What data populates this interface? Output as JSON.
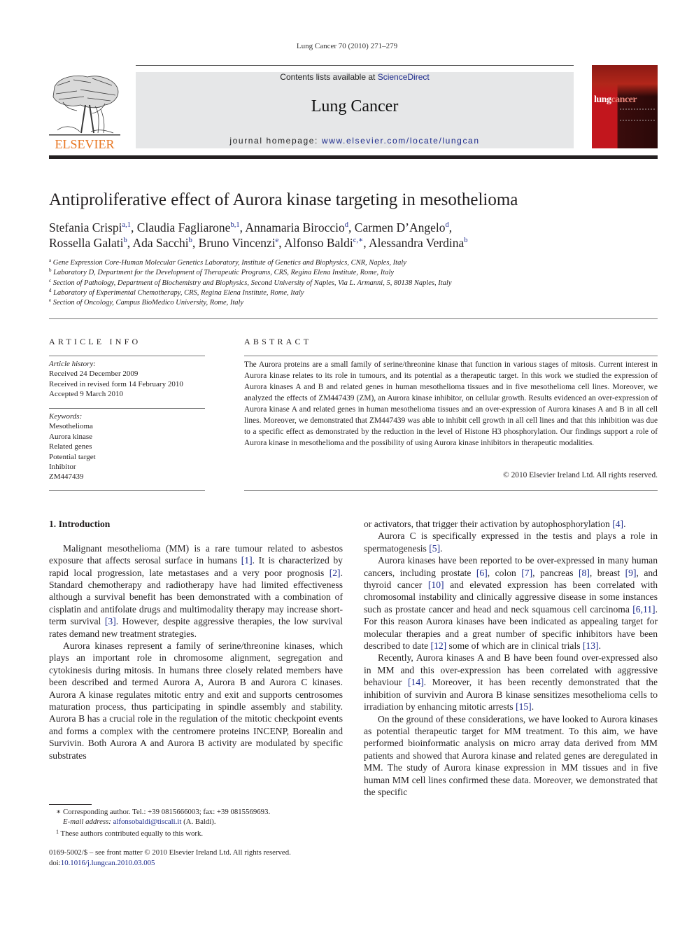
{
  "running_head": "Lung Cancer 70 (2010) 271–279",
  "masthead": {
    "publisher_logo_text": "ELSEVIER",
    "contents_prefix": "Contents lists available at ",
    "contents_link": "ScienceDirect",
    "journal_name": "Lung Cancer",
    "homepage_prefix": "journal homepage: ",
    "homepage_link": "www.elsevier.com/locate/lungcan",
    "cover_title_a": "lung",
    "cover_title_b": "cancer"
  },
  "article": {
    "title": "Antiproliferative effect of Aurora kinase targeting in mesothelioma",
    "authors": [
      {
        "name": "Stefania Crispi",
        "sup": "a,1",
        "sep": ", "
      },
      {
        "name": "Claudia Fagliarone",
        "sup": "b,1",
        "sep": ", "
      },
      {
        "name": "Annamaria Biroccio",
        "sup": "d",
        "sep": ", "
      },
      {
        "name": "Carmen D’Angelo",
        "sup": "d",
        "sep": ","
      },
      {
        "name": "Rossella Galati",
        "sup": "b",
        "sep": ", "
      },
      {
        "name": "Ada Sacchi",
        "sup": "b",
        "sep": ", "
      },
      {
        "name": "Bruno Vincenzi",
        "sup": "e",
        "sep": ", "
      },
      {
        "name": "Alfonso Baldi",
        "sup": "c,∗",
        "sep": ", "
      },
      {
        "name": "Alessandra Verdina",
        "sup": "b",
        "sep": ""
      }
    ],
    "affiliations": [
      {
        "key": "a",
        "text": "Gene Expression Core-Human Molecular Genetics Laboratory, Institute of Genetics and Biophysics, CNR, Naples, Italy"
      },
      {
        "key": "b",
        "text": "Laboratory D, Department for the Development of Therapeutic Programs, CRS, Regina Elena Institute, Rome, Italy"
      },
      {
        "key": "c",
        "text": "Section of Pathology, Department of Biochemistry and Biophysics, Second University of Naples, Via L. Armanni, 5, 80138 Naples, Italy"
      },
      {
        "key": "d",
        "text": "Laboratory of Experimental Chemotherapy, CRS, Regina Elena Institute, Rome, Italy"
      },
      {
        "key": "e",
        "text": "Section of Oncology, Campus BioMedico University, Rome, Italy"
      }
    ]
  },
  "article_info": {
    "heading": "ARTICLE INFO",
    "history_label": "Article history:",
    "history": [
      "Received 24 December 2009",
      "Received in revised form 14 February 2010",
      "Accepted 9 March 2010"
    ],
    "keywords_label": "Keywords:",
    "keywords": [
      "Mesothelioma",
      "Aurora kinase",
      "Related genes",
      "Potential target",
      "Inhibitor",
      "ZM447439"
    ]
  },
  "abstract": {
    "heading": "ABSTRACT",
    "text": "The Aurora proteins are a small family of serine/threonine kinase that function in various stages of mitosis. Current interest in Aurora kinase relates to its role in tumours, and its potential as a therapeutic target. In this work we studied the expression of Aurora kinases A and B and related genes in human mesothelioma tissues and in five mesothelioma cell lines. Moreover, we analyzed the effects of ZM447439 (ZM), an Aurora kinase inhibitor, on cellular growth. Results evidenced an over-expression of Aurora kinase A and related genes in human mesothelioma tissues and an over-expression of Aurora kinases A and B in all cell lines. Moreover, we demonstrated that ZM447439 was able to inhibit cell growth in all cell lines and that this inhibition was due to a specific effect as demonstrated by the reduction in the level of Histone H3 phosphorylation. Our findings support a role of Aurora kinase in mesothelioma and the possibility of using Aurora kinase inhibitors in therapeutic modalities.",
    "copyright": "© 2010 Elsevier Ireland Ltd. All rights reserved."
  },
  "body": {
    "intro_heading": "1.  Introduction",
    "left_paragraphs": [
      [
        {
          "t": "Malignant mesothelioma (MM) is a rare tumour related to asbestos exposure that affects serosal surface in humans "
        },
        {
          "ref": "[1]"
        },
        {
          "t": ". It is characterized by rapid local progression, late metastases and a very poor prognosis "
        },
        {
          "ref": "[2]"
        },
        {
          "t": ". Standard chemotherapy and radiotherapy have had limited effectiveness although a survival benefit has been demonstrated with a combination of cisplatin and antifolate drugs and multimodality therapy may increase short-term survival "
        },
        {
          "ref": "[3]"
        },
        {
          "t": ". However, despite aggressive therapies, the low survival rates demand new treatment strategies."
        }
      ],
      [
        {
          "t": "Aurora kinases represent a family of serine/threonine kinases, which plays an important role in chromosome alignment, segregation and cytokinesis during mitosis. In humans three closely related members have been described and termed Aurora A, Aurora B and Aurora C kinases. Aurora A kinase regulates mitotic entry and exit and supports centrosomes maturation process, thus participating in spindle assembly and stability. Aurora B has a crucial role in the regulation of the mitotic checkpoint events and forms a complex with the centromere proteins INCENP, Borealin and Survivin. Both Aurora A and Aurora B activity are modulated by specific substrates"
        }
      ]
    ],
    "right_paragraphs": [
      {
        "indent": false,
        "runs": [
          {
            "t": "or activators, that trigger their activation by autophosphorylation "
          },
          {
            "ref": "[4]"
          },
          {
            "t": "."
          }
        ]
      },
      {
        "indent": true,
        "runs": [
          {
            "t": "Aurora C is specifically expressed in the testis and plays a role in spermatogenesis "
          },
          {
            "ref": "[5]"
          },
          {
            "t": "."
          }
        ]
      },
      {
        "indent": true,
        "runs": [
          {
            "t": "Aurora kinases have been reported to be over-expressed in many human cancers, including prostate "
          },
          {
            "ref": "[6]"
          },
          {
            "t": ", colon "
          },
          {
            "ref": "[7]"
          },
          {
            "t": ", pancreas "
          },
          {
            "ref": "[8]"
          },
          {
            "t": ", breast "
          },
          {
            "ref": "[9]"
          },
          {
            "t": ", and thyroid cancer "
          },
          {
            "ref": "[10]"
          },
          {
            "t": " and elevated expression has been correlated with chromosomal instability and clinically aggressive disease in some instances such as prostate cancer and head and neck squamous cell carcinoma "
          },
          {
            "ref": "[6,11]"
          },
          {
            "t": ". For this reason Aurora kinases have been indicated as appealing target for molecular therapies and a great number of specific inhibitors have been described to date "
          },
          {
            "ref": "[12]"
          },
          {
            "t": " some of which are in clinical trials "
          },
          {
            "ref": "[13]"
          },
          {
            "t": "."
          }
        ]
      },
      {
        "indent": true,
        "runs": [
          {
            "t": "Recently, Aurora kinases A and B have been found over-expressed also in MM and this over-expression has been correlated with aggressive behaviour "
          },
          {
            "ref": "[14]"
          },
          {
            "t": ". Moreover, it has been recently demonstrated that the inhibition of survivin and Aurora B kinase sensitizes mesothelioma cells to irradiation by enhancing mitotic arrests "
          },
          {
            "ref": "[15]"
          },
          {
            "t": "."
          }
        ]
      },
      {
        "indent": true,
        "runs": [
          {
            "t": "On the ground of these considerations, we have looked to Aurora kinases as potential therapeutic target for MM treatment. To this aim, we have performed bioinformatic analysis on micro array data derived from MM patients and showed that Aurora kinase and related genes are deregulated in MM. The study of Aurora kinase expression in MM tissues and in five human MM cell lines confirmed these data. Moreover, we demonstrated that the specific"
          }
        ]
      }
    ]
  },
  "footnotes": {
    "corresponding_mark": "∗",
    "corresponding": "Corresponding author. Tel.: +39 0815666003; fax: +39 0815569693.",
    "email_label": "E-mail address:",
    "email": "alfonsobaldi@tiscali.it",
    "email_suffix": " (A. Baldi).",
    "equal_mark": "1",
    "equal": "These authors contributed equally to this work."
  },
  "front_matter": {
    "issn_line": "0169-5002/$ – see front matter © 2010 Elsevier Ireland Ltd. All rights reserved.",
    "doi_prefix": "doi:",
    "doi": "10.1016/j.lungcan.2010.03.005"
  },
  "colors": {
    "link": "#1c2a8c",
    "elsevier_orange": "#e87722",
    "masthead_gray": "#e6e7e8",
    "cover_red": "#c2161d"
  }
}
